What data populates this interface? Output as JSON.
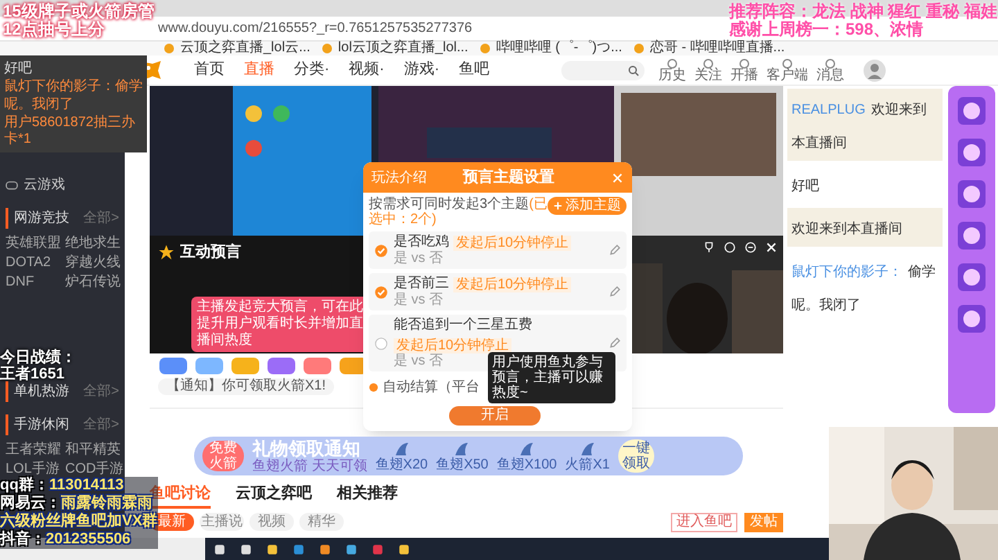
{
  "overlay_top_left": [
    "15级牌子或火箭房管",
    "12点抽号上分"
  ],
  "overlay_top_right": [
    "推荐阵容：龙法 战神 猩红 重秘 福娃",
    "感谢上周榜一：598、浓情"
  ],
  "browser": {
    "url": "www.douyu.com/216555?_r=0.7651257535277376",
    "bookmarks": [
      "云顶之弈直播_lol云...",
      "lol云顶之弈直播_lol...",
      "哔哩哔哩 (゜-゜)つ...",
      "恋哥 - 哔哩哔哩直播..."
    ]
  },
  "site_nav": {
    "items": [
      {
        "label": "首页",
        "selected": false
      },
      {
        "label": "直播",
        "selected": true
      },
      {
        "label": "分类·",
        "selected": false
      },
      {
        "label": "视频·",
        "selected": false
      },
      {
        "label": "游戏·",
        "selected": false
      },
      {
        "label": "鱼吧",
        "selected": false
      }
    ],
    "header_actions": [
      "历史",
      "关注",
      "开播",
      "客户端",
      "消息"
    ]
  },
  "sidebar": {
    "top_item": "云游戏",
    "sections": [
      {
        "title": "网游竞技",
        "more": "全部>",
        "items": [
          "英雄联盟",
          "绝地求生",
          "DOTA2",
          "穿越火线",
          "DNF",
          "炉石传说"
        ]
      },
      {
        "title": "单机热游",
        "more": "全部>"
      },
      {
        "title": "手游休闲",
        "more": "全部>",
        "items": [
          "王者荣耀",
          "和平精英",
          "LOL手游",
          "COD手游"
        ]
      }
    ]
  },
  "overlay_left_chat": [
    "好吧",
    "鼠灯下你的影子：偷学",
    "呢。我闭了",
    "用户58601872抽三办卡*1"
  ],
  "overlay_stats": [
    "今日战绩：",
    "王者1651"
  ],
  "overlay_bottom_left": [
    {
      "label": "qq群：",
      "value": "113014113"
    },
    {
      "label": "网易云：",
      "value": "雨露铃雨霖雨"
    },
    {
      "value": "六级粉丝牌鱼吧加VX群"
    },
    {
      "label": "抖音：",
      "value": "2012355506"
    }
  ],
  "player": {
    "title": "互动预言",
    "tip": "主播发起竞大预言，可在此提升用户观看时长并增加直播间热度",
    "notice": "【通知】你可领取火箭X1!"
  },
  "modal": {
    "tab": "玩法介绍",
    "title": "预言主题设置",
    "hint": "按需求可同时发起3个主题",
    "hint_count": "(已选中：2个)",
    "add_button": "添加主题",
    "topics": [
      {
        "title": "是否吃鸡",
        "timer": "发起后10分钟停止",
        "options": "是 vs 否",
        "checked": true
      },
      {
        "title": "是否前三",
        "timer": "发起后10分钟停止",
        "options": "是 vs 否",
        "checked": true
      },
      {
        "title": "能否追到一个三星五费",
        "timer": "发起后10分钟停止",
        "options": "是 vs 否",
        "checked": false
      }
    ],
    "auto_settle": "自动结算（平台",
    "tooltip": "用户使用鱼丸参与预言，主播可以赚热度~",
    "start_button": "开启"
  },
  "chat": [
    {
      "name": "REALPLUG",
      "text": "欢迎来到本直播间"
    },
    {
      "text": "好吧"
    },
    {
      "text": "欢迎来到本直播间"
    },
    {
      "name": "鼠灯下你的影子：",
      "text": "偷学呢。我闭了"
    }
  ],
  "banner": {
    "badge": "免费火箭",
    "title": "礼物领取通知",
    "subtitle": "鱼翅火箭 天天可领",
    "gifts": [
      "鱼翅X20",
      "鱼翅X50",
      "鱼翅X100",
      "火箭X1"
    ],
    "claim": "一键领取"
  },
  "forum": {
    "tabs": [
      {
        "label": "鱼吧讨论",
        "selected": true
      },
      {
        "label": "云顶之弈吧",
        "selected": false
      },
      {
        "label": "相关推荐",
        "selected": false
      }
    ],
    "filters": [
      {
        "label": "最新",
        "selected": true
      },
      {
        "label": "主播说",
        "selected": false
      },
      {
        "label": "视频",
        "selected": false
      },
      {
        "label": "精华",
        "selected": false
      }
    ],
    "enter": "进入鱼吧",
    "post": "发帖"
  }
}
